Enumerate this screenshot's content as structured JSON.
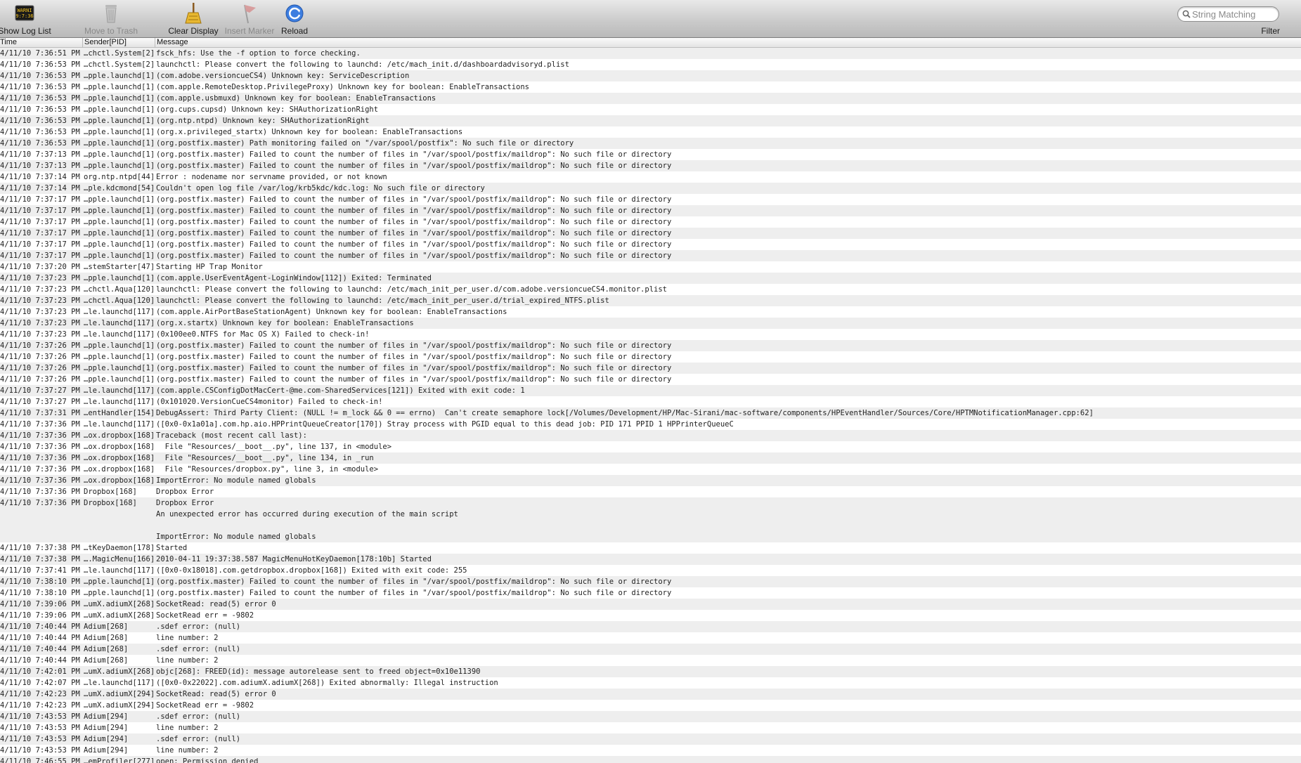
{
  "toolbar": {
    "show_log_list": "Show Log List",
    "move_to_trash": "Move to Trash",
    "clear_display": "Clear Display",
    "insert_marker": "Insert Marker",
    "reload": "Reload",
    "filter": "Filter",
    "search_placeholder": "String Matching",
    "log_icon_text_1": "WARNI",
    "log_icon_text_2": "9:7:36"
  },
  "columns": {
    "time": "Time",
    "sender": "Sender[PID]",
    "message": "Message"
  },
  "rows": [
    {
      "time": "4/11/10 7:36:51 PM",
      "sender": "…chctl.System[2]",
      "message": "fsck_hfs: Use the -f option to force checking."
    },
    {
      "time": "4/11/10 7:36:53 PM",
      "sender": "…chctl.System[2]",
      "message": "launchctl: Please convert the following to launchd: /etc/mach_init.d/dashboardadvisoryd.plist"
    },
    {
      "time": "4/11/10 7:36:53 PM",
      "sender": "…pple.launchd[1]",
      "message": "(com.adobe.versioncueCS4) Unknown key: ServiceDescription"
    },
    {
      "time": "4/11/10 7:36:53 PM",
      "sender": "…pple.launchd[1]",
      "message": "(com.apple.RemoteDesktop.PrivilegeProxy) Unknown key for boolean: EnableTransactions"
    },
    {
      "time": "4/11/10 7:36:53 PM",
      "sender": "…pple.launchd[1]",
      "message": "(com.apple.usbmuxd) Unknown key for boolean: EnableTransactions"
    },
    {
      "time": "4/11/10 7:36:53 PM",
      "sender": "…pple.launchd[1]",
      "message": "(org.cups.cupsd) Unknown key: SHAuthorizationRight"
    },
    {
      "time": "4/11/10 7:36:53 PM",
      "sender": "…pple.launchd[1]",
      "message": "(org.ntp.ntpd) Unknown key: SHAuthorizationRight"
    },
    {
      "time": "4/11/10 7:36:53 PM",
      "sender": "…pple.launchd[1]",
      "message": "(org.x.privileged_startx) Unknown key for boolean: EnableTransactions"
    },
    {
      "time": "4/11/10 7:36:53 PM",
      "sender": "…pple.launchd[1]",
      "message": "(org.postfix.master) Path monitoring failed on \"/var/spool/postfix\": No such file or directory"
    },
    {
      "time": "4/11/10 7:37:13 PM",
      "sender": "…pple.launchd[1]",
      "message": "(org.postfix.master) Failed to count the number of files in \"/var/spool/postfix/maildrop\": No such file or directory"
    },
    {
      "time": "4/11/10 7:37:13 PM",
      "sender": "…pple.launchd[1]",
      "message": "(org.postfix.master) Failed to count the number of files in \"/var/spool/postfix/maildrop\": No such file or directory"
    },
    {
      "time": "4/11/10 7:37:14 PM",
      "sender": "org.ntp.ntpd[44]",
      "message": "Error : nodename nor servname provided, or not known"
    },
    {
      "time": "4/11/10 7:37:14 PM",
      "sender": "…ple.kdcmond[54]",
      "message": "Couldn't open log file /var/log/krb5kdc/kdc.log: No such file or directory"
    },
    {
      "time": "4/11/10 7:37:17 PM",
      "sender": "…pple.launchd[1]",
      "message": "(org.postfix.master) Failed to count the number of files in \"/var/spool/postfix/maildrop\": No such file or directory"
    },
    {
      "time": "4/11/10 7:37:17 PM",
      "sender": "…pple.launchd[1]",
      "message": "(org.postfix.master) Failed to count the number of files in \"/var/spool/postfix/maildrop\": No such file or directory"
    },
    {
      "time": "4/11/10 7:37:17 PM",
      "sender": "…pple.launchd[1]",
      "message": "(org.postfix.master) Failed to count the number of files in \"/var/spool/postfix/maildrop\": No such file or directory"
    },
    {
      "time": "4/11/10 7:37:17 PM",
      "sender": "…pple.launchd[1]",
      "message": "(org.postfix.master) Failed to count the number of files in \"/var/spool/postfix/maildrop\": No such file or directory"
    },
    {
      "time": "4/11/10 7:37:17 PM",
      "sender": "…pple.launchd[1]",
      "message": "(org.postfix.master) Failed to count the number of files in \"/var/spool/postfix/maildrop\": No such file or directory"
    },
    {
      "time": "4/11/10 7:37:17 PM",
      "sender": "…pple.launchd[1]",
      "message": "(org.postfix.master) Failed to count the number of files in \"/var/spool/postfix/maildrop\": No such file or directory"
    },
    {
      "time": "4/11/10 7:37:20 PM",
      "sender": "…stemStarter[47]",
      "message": "Starting HP Trap Monitor"
    },
    {
      "time": "4/11/10 7:37:23 PM",
      "sender": "…pple.launchd[1]",
      "message": "(com.apple.UserEventAgent-LoginWindow[112]) Exited: Terminated"
    },
    {
      "time": "4/11/10 7:37:23 PM",
      "sender": "…chctl.Aqua[120]",
      "message": "launchctl: Please convert the following to launchd: /etc/mach_init_per_user.d/com.adobe.versioncueCS4.monitor.plist"
    },
    {
      "time": "4/11/10 7:37:23 PM",
      "sender": "…chctl.Aqua[120]",
      "message": "launchctl: Please convert the following to launchd: /etc/mach_init_per_user.d/trial_expired_NTFS.plist"
    },
    {
      "time": "4/11/10 7:37:23 PM",
      "sender": "…le.launchd[117]",
      "message": "(com.apple.AirPortBaseStationAgent) Unknown key for boolean: EnableTransactions"
    },
    {
      "time": "4/11/10 7:37:23 PM",
      "sender": "…le.launchd[117]",
      "message": "(org.x.startx) Unknown key for boolean: EnableTransactions"
    },
    {
      "time": "4/11/10 7:37:23 PM",
      "sender": "…le.launchd[117]",
      "message": "(0x100ee0.NTFS for Mac OS X) Failed to check-in!"
    },
    {
      "time": "4/11/10 7:37:26 PM",
      "sender": "…pple.launchd[1]",
      "message": "(org.postfix.master) Failed to count the number of files in \"/var/spool/postfix/maildrop\": No such file or directory"
    },
    {
      "time": "4/11/10 7:37:26 PM",
      "sender": "…pple.launchd[1]",
      "message": "(org.postfix.master) Failed to count the number of files in \"/var/spool/postfix/maildrop\": No such file or directory"
    },
    {
      "time": "4/11/10 7:37:26 PM",
      "sender": "…pple.launchd[1]",
      "message": "(org.postfix.master) Failed to count the number of files in \"/var/spool/postfix/maildrop\": No such file or directory"
    },
    {
      "time": "4/11/10 7:37:26 PM",
      "sender": "…pple.launchd[1]",
      "message": "(org.postfix.master) Failed to count the number of files in \"/var/spool/postfix/maildrop\": No such file or directory"
    },
    {
      "time": "4/11/10 7:37:27 PM",
      "sender": "…le.launchd[117]",
      "message": "(com.apple.CSConfigDotMacCert-@me.com-SharedServices[121]) Exited with exit code: 1"
    },
    {
      "time": "4/11/10 7:37:27 PM",
      "sender": "…le.launchd[117]",
      "message": "(0x101020.VersionCueCS4monitor) Failed to check-in!"
    },
    {
      "time": "4/11/10 7:37:31 PM",
      "sender": "…entHandler[154]",
      "message": "DebugAssert: Third Party Client: (NULL != m_lock && 0 == errno)  Can't create semaphore lock[/Volumes/Development/HP/Mac-Sirani/mac-software/components/HPEventHandler/Sources/Core/HPTMNotificationManager.cpp:62]"
    },
    {
      "time": "4/11/10 7:37:36 PM",
      "sender": "…le.launchd[117]",
      "message": "([0x0-0x1a01a].com.hp.aio.HPPrintQueueCreator[170]) Stray process with PGID equal to this dead job: PID 171 PPID 1 HPPrinterQueueC"
    },
    {
      "time": "4/11/10 7:37:36 PM",
      "sender": "…ox.dropbox[168]",
      "message": "Traceback (most recent call last):"
    },
    {
      "time": "4/11/10 7:37:36 PM",
      "sender": "…ox.dropbox[168]",
      "message": "  File \"Resources/__boot__.py\", line 137, in <module>"
    },
    {
      "time": "4/11/10 7:37:36 PM",
      "sender": "…ox.dropbox[168]",
      "message": "  File \"Resources/__boot__.py\", line 134, in _run"
    },
    {
      "time": "4/11/10 7:37:36 PM",
      "sender": "…ox.dropbox[168]",
      "message": "  File \"Resources/dropbox.py\", line 3, in <module>"
    },
    {
      "time": "4/11/10 7:37:36 PM",
      "sender": "…ox.dropbox[168]",
      "message": "ImportError: No module named globals"
    },
    {
      "time": "4/11/10 7:37:36 PM",
      "sender": "Dropbox[168]",
      "message": "Dropbox Error"
    },
    {
      "time": "4/11/10 7:37:36 PM",
      "sender": "Dropbox[168]",
      "message": "Dropbox Error\nAn unexpected error has occurred during execution of the main script\n\nImportError: No module named globals"
    },
    {
      "time": "4/11/10 7:37:38 PM",
      "sender": "…tKeyDaemon[178]",
      "message": "Started"
    },
    {
      "time": "4/11/10 7:37:38 PM",
      "sender": "….MagicMenu[166]",
      "message": "2010-04-11 19:37:38.587 MagicMenuHotKeyDaemon[178:10b] Started"
    },
    {
      "time": "4/11/10 7:37:41 PM",
      "sender": "…le.launchd[117]",
      "message": "([0x0-0x18018].com.getdropbox.dropbox[168]) Exited with exit code: 255"
    },
    {
      "time": "4/11/10 7:38:10 PM",
      "sender": "…pple.launchd[1]",
      "message": "(org.postfix.master) Failed to count the number of files in \"/var/spool/postfix/maildrop\": No such file or directory"
    },
    {
      "time": "4/11/10 7:38:10 PM",
      "sender": "…pple.launchd[1]",
      "message": "(org.postfix.master) Failed to count the number of files in \"/var/spool/postfix/maildrop\": No such file or directory"
    },
    {
      "time": "4/11/10 7:39:06 PM",
      "sender": "…umX.adiumX[268]",
      "message": "SocketRead: read(5) error 0"
    },
    {
      "time": "4/11/10 7:39:06 PM",
      "sender": "…umX.adiumX[268]",
      "message": "SocketRead err = -9802"
    },
    {
      "time": "4/11/10 7:40:44 PM",
      "sender": "Adium[268]",
      "message": ".sdef error: (null)"
    },
    {
      "time": "4/11/10 7:40:44 PM",
      "sender": "Adium[268]",
      "message": "line number: 2"
    },
    {
      "time": "4/11/10 7:40:44 PM",
      "sender": "Adium[268]",
      "message": ".sdef error: (null)"
    },
    {
      "time": "4/11/10 7:40:44 PM",
      "sender": "Adium[268]",
      "message": "line number: 2"
    },
    {
      "time": "4/11/10 7:42:01 PM",
      "sender": "…umX.adiumX[268]",
      "message": "objc[268]: FREED(id): message autorelease sent to freed object=0x10e11390"
    },
    {
      "time": "4/11/10 7:42:07 PM",
      "sender": "…le.launchd[117]",
      "message": "([0x0-0x22022].com.adiumX.adiumX[268]) Exited abnormally: Illegal instruction"
    },
    {
      "time": "4/11/10 7:42:23 PM",
      "sender": "…umX.adiumX[294]",
      "message": "SocketRead: read(5) error 0"
    },
    {
      "time": "4/11/10 7:42:23 PM",
      "sender": "…umX.adiumX[294]",
      "message": "SocketRead err = -9802"
    },
    {
      "time": "4/11/10 7:43:53 PM",
      "sender": "Adium[294]",
      "message": ".sdef error: (null)"
    },
    {
      "time": "4/11/10 7:43:53 PM",
      "sender": "Adium[294]",
      "message": "line number: 2"
    },
    {
      "time": "4/11/10 7:43:53 PM",
      "sender": "Adium[294]",
      "message": ".sdef error: (null)"
    },
    {
      "time": "4/11/10 7:43:53 PM",
      "sender": "Adium[294]",
      "message": "line number: 2"
    },
    {
      "time": "4/11/10 7:46:55 PM",
      "sender": "…emProfiler[277]",
      "message": "open: Permission denied"
    }
  ],
  "selected_row": 61,
  "colors": {
    "selection": "#a7b4c8",
    "alt_row": "#eeeeee",
    "toolbar": "#c9c9c9"
  }
}
